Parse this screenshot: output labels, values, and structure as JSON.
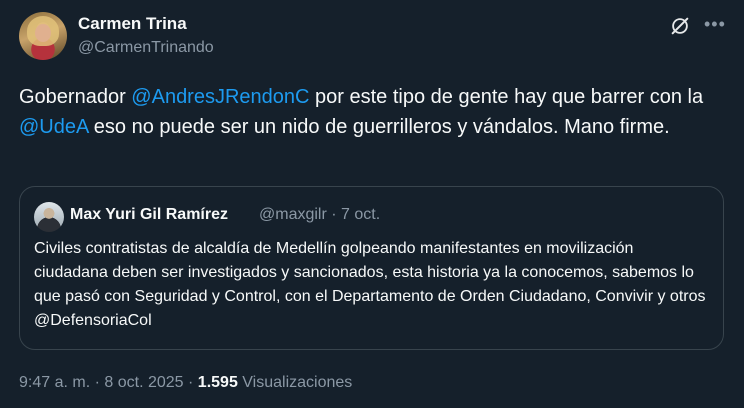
{
  "author": {
    "display_name": "Carmen Trina",
    "handle": "@CarmenTrinando"
  },
  "header_icons": {
    "grok": "grok-icon",
    "more": "more-icon"
  },
  "tweet": {
    "text_part1": "Gobernador ",
    "mention1": "@AndresJRendonC",
    "text_part2": " por este tipo de gente hay que barrer con la ",
    "mention2": "@UdeA",
    "text_part3": " eso no puede ser un nido de guerrilleros y vándalos. Mano firme."
  },
  "quoted": {
    "display_name": "Max Yuri Gil Ramírez",
    "handle": "@maxgilr",
    "separator": "·",
    "date": "7 oct.",
    "text": "Civiles contratistas de alcaldía de Medellín golpeando manifestantes en movilización ciudadana deben ser investigados y sancionados, esta historia ya la conocemos, sabemos lo que pasó con Seguridad y Control, con el Departamento de Orden Ciudadano, Convivir y otros @DefensoriaCol"
  },
  "footer": {
    "time": "9:47 a. m.",
    "separator": "·",
    "date": "8 oct. 2025",
    "separator2": "·",
    "views_count": "1.595",
    "views_label": "Visualizaciones"
  },
  "colors": {
    "background": "#15202b",
    "text": "#f7f9f9",
    "secondary": "#8b98a5",
    "link": "#1d9bf0",
    "border": "#38444d"
  }
}
